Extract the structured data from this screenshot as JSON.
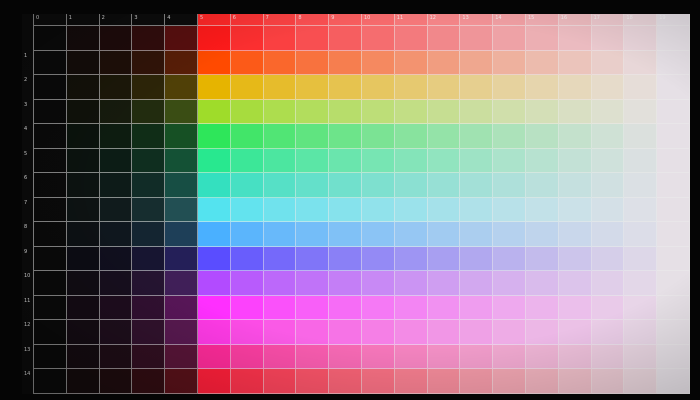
{
  "photo": {
    "description_icon": "color-grid-icon"
  },
  "grid": {
    "column_labels": [
      "0",
      "1",
      "2",
      "3",
      "4",
      "5",
      "6",
      "7",
      "8",
      "9",
      "10",
      "11",
      "12",
      "13",
      "14",
      "15",
      "16",
      "17",
      "18",
      "19"
    ],
    "row_labels": [
      "",
      "1",
      "2",
      "3",
      "4",
      "5",
      "6",
      "7",
      "8",
      "9",
      "10",
      "11",
      "12",
      "13",
      "14"
    ],
    "hues": [
      "#ff1a1a",
      "#ff4a00",
      "#e6b400",
      "#9fdc2a",
      "#2ee65a",
      "#28e88f",
      "#34e0bf",
      "#54e3ef",
      "#4ab0ff",
      "#5a4dff",
      "#b24bff",
      "#ff2fff",
      "#ff3ae6",
      "#ff2b9a",
      "#ff1f3a"
    ],
    "dark_columns": 5,
    "light_columns": 15,
    "background": "#0a0a0a",
    "end_tint": "#e6e0e6"
  }
}
